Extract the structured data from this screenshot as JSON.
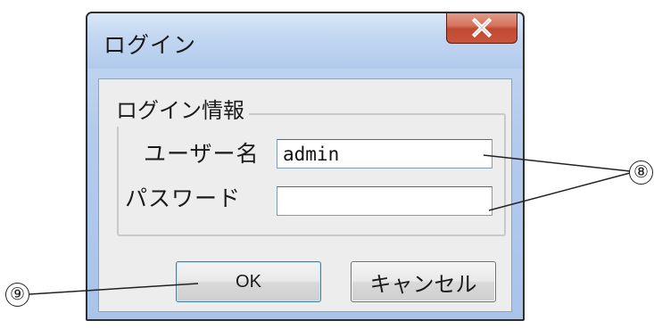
{
  "window": {
    "title": "ログイン",
    "close_label": "x"
  },
  "login_group": {
    "legend": "ログイン情報",
    "username_label": "ユーザー名",
    "username_value": "admin",
    "password_label": "パスワード",
    "password_value": ""
  },
  "buttons": {
    "ok_label": "OK",
    "cancel_label": "キャンセル"
  },
  "callouts": {
    "fields_marker": "⑧",
    "ok_marker": "⑨"
  },
  "icons": {
    "close": "close-icon"
  },
  "colors": {
    "close_button": "#c7553b",
    "frame": "#b3cbec",
    "client_background": "#ededed",
    "ok_focus_border": "#3c7fb1"
  }
}
